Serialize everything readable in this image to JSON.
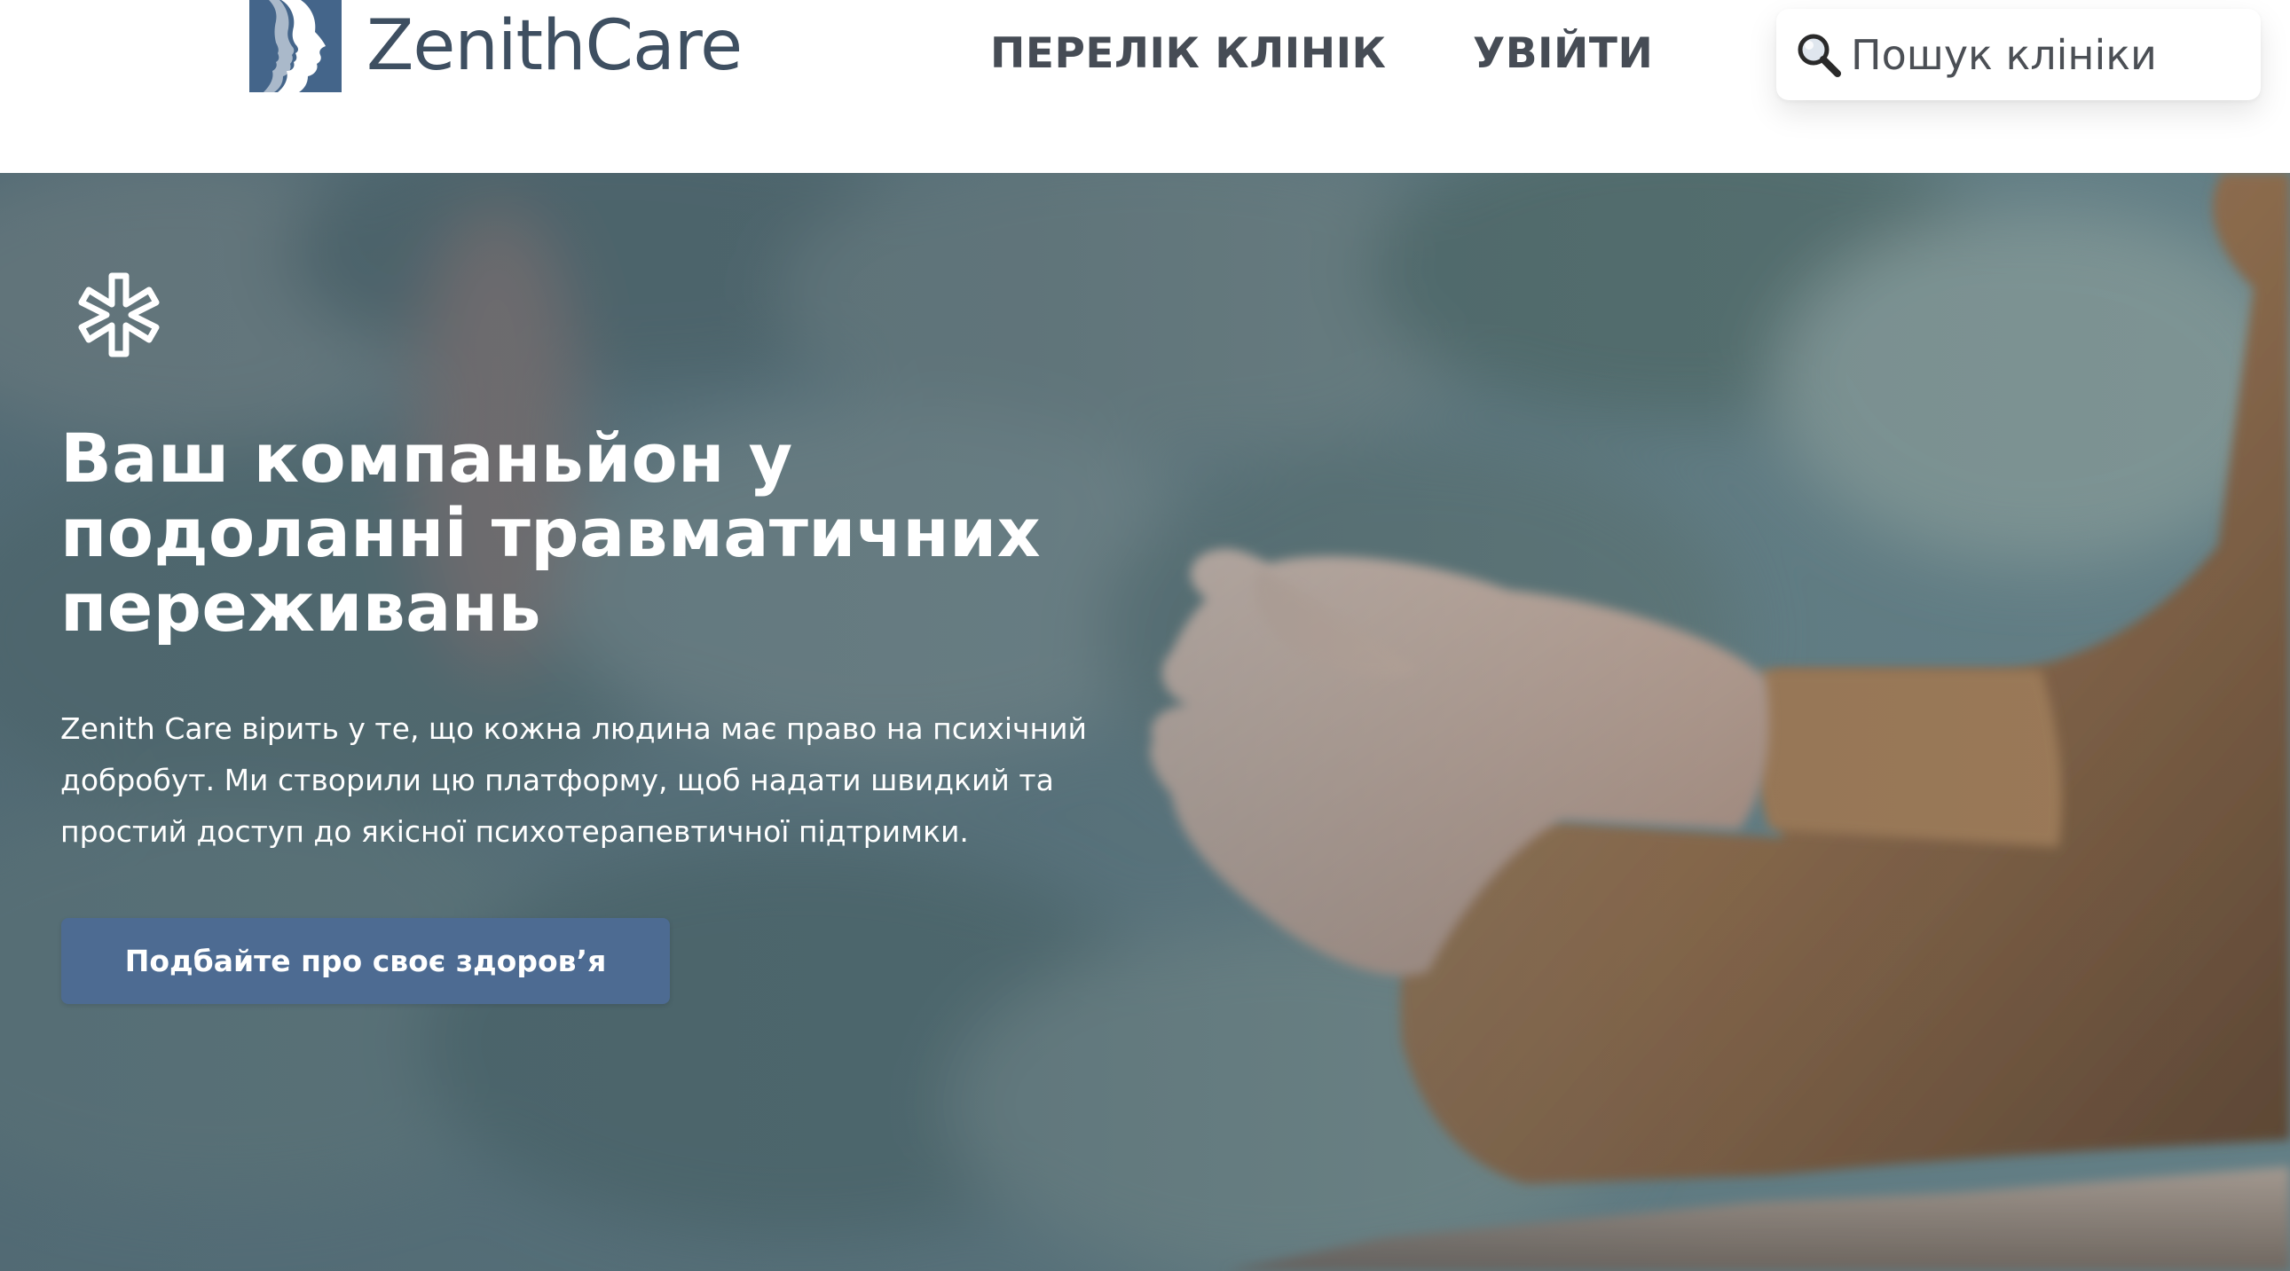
{
  "brand": {
    "name": "ZenithCare",
    "accent": "#44658a"
  },
  "nav": {
    "clinics_label": "ПЕРЕЛІК КЛІНІК",
    "login_label": "УВІЙТИ"
  },
  "search": {
    "placeholder": "Пошук клініки",
    "value": ""
  },
  "hero": {
    "title": "Ваш компаньйон у подоланні травматичних переживань",
    "description": "Zenith Care вірить у те, що кожна людина має право на психічний добробут. Ми створили цю платформу, щоб надати швидкий та простий доступ до якісної психотерапевтичної підтримки.",
    "cta_label": "Подбайте про своє здоров’я",
    "cta_color": "#4d6b92",
    "background": "photo of clasped hands in a brown knit sweater resting on a wooden railing, blurred forest behind"
  }
}
